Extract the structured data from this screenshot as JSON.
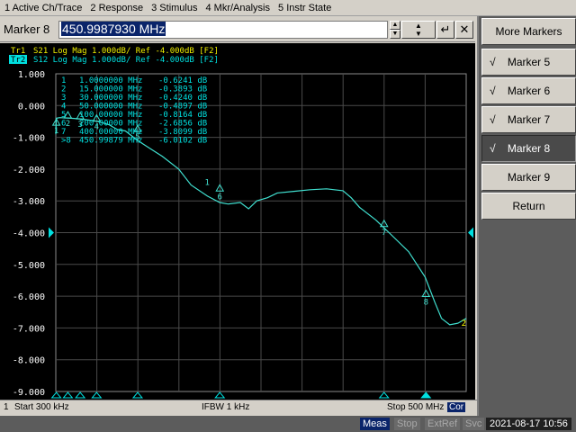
{
  "menu": [
    "1 Active Ch/Trace",
    "2 Response",
    "3 Stimulus",
    "4 Mkr/Analysis",
    "5 Instr State"
  ],
  "entry": {
    "label": "Marker 8",
    "value": "450.9987930 MHz"
  },
  "softkeys": {
    "title": "More Markers",
    "items": [
      {
        "label": "Marker 5",
        "checked": true,
        "active": false
      },
      {
        "label": "Marker 6",
        "checked": true,
        "active": false
      },
      {
        "label": "Marker 7",
        "checked": true,
        "active": false
      },
      {
        "label": "Marker 8",
        "checked": true,
        "active": true
      },
      {
        "label": "Marker 9",
        "checked": false,
        "active": false
      },
      {
        "label": "Return",
        "checked": false,
        "active": false
      }
    ],
    "check_glyph": "√"
  },
  "trace_header": [
    {
      "tag": "Tr1",
      "text": "S21 Log Mag 1.000dB/ Ref -4.000dB [F2]",
      "color": "#f0f000",
      "active": false
    },
    {
      "tag": "Tr2",
      "text": "S12 Log Mag 1.000dB/ Ref -4.000dB [F2]",
      "color": "#00e0e0",
      "active": true
    }
  ],
  "markers_table": [
    {
      "n": "1",
      "freq": "1.0000000 MHz",
      "val": "-0.6241 dB"
    },
    {
      "n": "2",
      "freq": "15.000000 MHz",
      "val": "-0.3893 dB"
    },
    {
      "n": "3",
      "freq": "30.000000 MHz",
      "val": "-0.4240 dB"
    },
    {
      "n": "4",
      "freq": "50.000000 MHz",
      "val": "-0.4897 dB"
    },
    {
      "n": "5",
      "freq": "100.00000 MHz",
      "val": "-0.8164 dB"
    },
    {
      "n": "6",
      "freq": "200.00000 MHz",
      "val": "-2.6856 dB"
    },
    {
      "n": "7",
      "freq": "400.00000 MHz",
      "val": "-3.8099 dB"
    },
    {
      "n": ">8",
      "freq": "450.99879 MHz",
      "val": "-6.0102 dB"
    }
  ],
  "chart_data": {
    "type": "line",
    "xlim": [
      0.3,
      500
    ],
    "ylim": [
      -9,
      1
    ],
    "y_ticks": [
      "1.000",
      "0.000",
      "-1.000",
      "-2.000",
      "-3.000",
      "-4.000",
      "-5.000",
      "-6.000",
      "-7.000",
      "-8.000",
      "-9.000"
    ],
    "ref_level": -4,
    "series": [
      {
        "name": "S12",
        "color": "#40e0d0",
        "x": [
          0.3,
          1,
          5,
          15,
          30,
          50,
          65,
          75,
          85,
          100,
          115,
          130,
          150,
          165,
          185,
          200,
          210,
          225,
          235,
          245,
          258,
          270,
          290,
          310,
          330,
          350,
          360,
          370,
          390,
          410,
          430,
          450,
          462,
          470,
          480,
          490,
          500
        ],
        "y": [
          -0.9,
          -0.4,
          -0.38,
          -0.39,
          -0.42,
          -0.49,
          -0.6,
          -0.75,
          -0.8,
          -1.1,
          -1.35,
          -1.6,
          -2.0,
          -2.5,
          -2.85,
          -3.05,
          -3.1,
          -3.05,
          -3.25,
          -3.0,
          -2.9,
          -2.75,
          -2.7,
          -2.65,
          -2.62,
          -2.68,
          -2.9,
          -3.2,
          -3.6,
          -4.1,
          -4.6,
          -5.4,
          -6.2,
          -6.7,
          -6.9,
          -6.85,
          -6.7
        ]
      }
    ],
    "markers": [
      {
        "label": "1",
        "x": 1,
        "y": -0.62
      },
      {
        "label": "2",
        "x": 15,
        "y": -0.39
      },
      {
        "label": "3",
        "x": 30,
        "y": -0.42
      },
      {
        "label": "4",
        "x": 50,
        "y": -0.49
      },
      {
        "label": "5",
        "x": 100,
        "y": -0.82
      },
      {
        "label": "6",
        "x": 200,
        "y": -2.69
      },
      {
        "label": "7",
        "x": 400,
        "y": -3.81
      },
      {
        "label": "8",
        "x": 451,
        "y": -6.01
      }
    ],
    "marker_label_7_on_trace": "1",
    "right_end_label": "2",
    "grid": true
  },
  "channel": {
    "n": "1",
    "start": "Start 300 kHz",
    "ifbw": "IFBW 1 kHz",
    "stop": "Stop 500 MHz",
    "cor": "Cor"
  },
  "status": {
    "items": [
      {
        "label": "Meas",
        "on": true
      },
      {
        "label": "Stop",
        "on": false
      },
      {
        "label": "ExtRef",
        "on": false
      },
      {
        "label": "Svc",
        "on": false
      }
    ],
    "datetime": "2021-08-17 10:56"
  }
}
